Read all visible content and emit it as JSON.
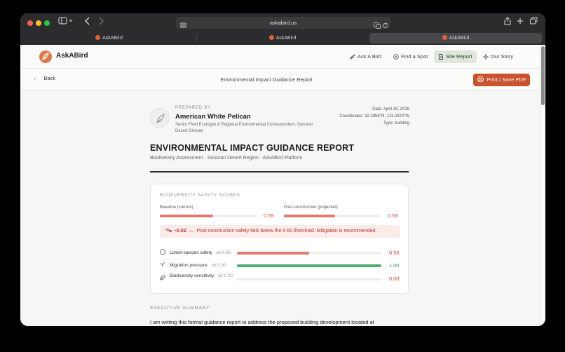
{
  "browser": {
    "url": "askabird.us",
    "tabs": [
      {
        "label": "AskABird",
        "active": false
      },
      {
        "label": "AskABird",
        "active": false
      },
      {
        "label": "AskABird",
        "active": true
      }
    ]
  },
  "nav": {
    "brand": "AskABird",
    "items": [
      {
        "label": "Ask A Bird",
        "icon": "feather-icon",
        "active": false
      },
      {
        "label": "Find a Spot",
        "icon": "compass-icon",
        "active": false
      },
      {
        "label": "Site Report",
        "icon": "document-icon",
        "active": true
      },
      {
        "label": "Our Story",
        "icon": "sparkle-icon",
        "active": false
      }
    ]
  },
  "subbar": {
    "back_label": "Back",
    "title": "Environmental Impact Guidance Report",
    "print_label": "Print / Save PDF"
  },
  "author": {
    "prepared_by_label": "PREPARED BY",
    "name": "American White Pelican",
    "role": "Senior Field Ecologist & Regional Environmental Correspondent, Sonoran Desert Division"
  },
  "meta": {
    "date_label": "Date:",
    "date": "April 26, 2026",
    "coords_label": "Coordinates:",
    "coords": "32.2856°N, 111.0320°W",
    "type_label": "Type:",
    "type": "building"
  },
  "report": {
    "title": "ENVIRONMENTAL IMPACT GUIDANCE REPORT",
    "subtitle": "Biodiversity Assessment · Sonoran Desert Region · AskABird Platform"
  },
  "scores": {
    "section_label": "BIODIVERSITY SAFETY SCORES",
    "baseline": {
      "label": "Baseline (current)",
      "value": 0.55,
      "value_text": "0.55"
    },
    "post": {
      "label": "Post-construction (projected)",
      "value": 0.53,
      "value_text": "0.53"
    },
    "alert": {
      "delta": "−0.02",
      "separator": "—",
      "message": "Post-construction safety falls below the 0.60 threshold. Mitigation is recommended."
    },
    "metrics": [
      {
        "label": "Listed-species safety",
        "weight": "· wt 0.50",
        "value": 0.5,
        "value_text": "0.50",
        "color": "#e07a72",
        "value_color": "#c9453a",
        "icon": "shield-icon"
      },
      {
        "label": "Migration pressure",
        "weight": "· wt 0.30",
        "value": 1.0,
        "value_text": "1.00",
        "color": "#4fae6e",
        "value_color": "#2f8a4c",
        "icon": "bird-icon"
      },
      {
        "label": "Biodiversity sensitivity",
        "weight": "· wt 0.20",
        "value": 0.0,
        "value_text": "0.00",
        "color": "#e07a72",
        "value_color": "#c9453a",
        "icon": "leaf-icon"
      }
    ]
  },
  "executive": {
    "label": "EXECUTIVE SUMMARY",
    "text": "I am writing this formal guidance report to address the proposed building development located at"
  },
  "colors": {
    "accent": "#c8532e",
    "alert_bg": "#fbecea",
    "bad": "#e07a72",
    "good": "#4fae6e"
  }
}
